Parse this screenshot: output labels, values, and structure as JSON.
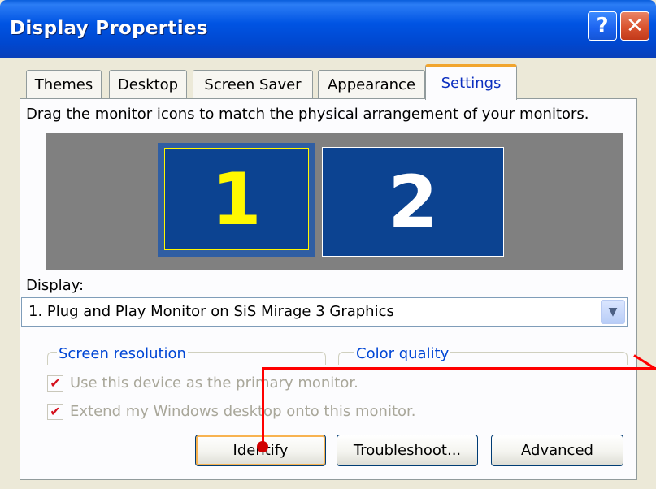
{
  "window": {
    "title": "Display Properties",
    "help_glyph": "?",
    "close_glyph": "✕"
  },
  "tabs": [
    {
      "label": "Themes"
    },
    {
      "label": "Desktop"
    },
    {
      "label": "Screen Saver"
    },
    {
      "label": "Appearance"
    },
    {
      "label": "Settings",
      "active": true
    }
  ],
  "settings": {
    "hint": "Drag the monitor icons to match the physical arrangement of your monitors.",
    "monitors": [
      {
        "number": "1",
        "selected": true,
        "color": "#fff800"
      },
      {
        "number": "2",
        "selected": false,
        "color": "#ffffff"
      }
    ],
    "display_label": "Display:",
    "display_value": "1. Plug and Play Monitor on SiS Mirage 3 Graphics",
    "groups": {
      "screen_resolution": "Screen resolution",
      "color_quality": "Color quality"
    },
    "checkboxes": [
      {
        "label": "Use this device as the primary monitor.",
        "checked": true,
        "enabled": false
      },
      {
        "label": "Extend my Windows desktop onto this monitor.",
        "checked": true,
        "enabled": false
      }
    ],
    "buttons": {
      "identify": "Identify",
      "troubleshoot": "Troubleshoot...",
      "advanced": "Advanced"
    }
  },
  "colors": {
    "titlebar": "#0054e3",
    "monitor_bg": "#0c4391",
    "callout": "#ff0000",
    "active_tab_accent": "#f1a52e"
  }
}
